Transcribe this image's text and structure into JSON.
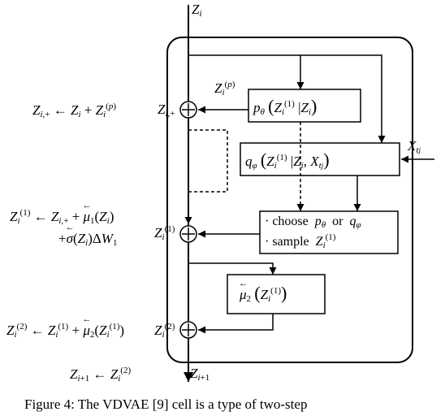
{
  "labels": {
    "Z_top": "Z_i",
    "Z_ip": "Z_i^(p)",
    "p_theta": "p_θ(Z_i^(1) | Z_i)",
    "q_phi": "q_φ(Z_i^(1) | Z_i, X_t_j)",
    "X_tj": "X_t_j",
    "choose": "· choose  p_θ  or  q_φ",
    "sample": "· sample  Z_i^(1)",
    "step1": "Z_i,+ ← Z_i + Z_i^(p)",
    "Z_iplus_axis": "Z_i,+",
    "step2a": "Z_i^(1) ← Z_i,+ + μ←_1(Z_i)",
    "step2b": "+ σ←(Z_i) ΔW_1",
    "Z_i1_axis": "Z_i^(1)",
    "mu2_block": "μ←_2(Z_i^(1))",
    "step3": "Z_i^(2) ← Z_i^(1) + μ←_2(Z_i^(1))",
    "Z_i2_axis": "Z_i^(2)",
    "step_out": "Z_(i+1) ← Z_i^(2)",
    "Z_bottom": "Z_(i+1)"
  },
  "figurecaption": "Figure 4: The VDVAE [9] cell is a type of two-step"
}
